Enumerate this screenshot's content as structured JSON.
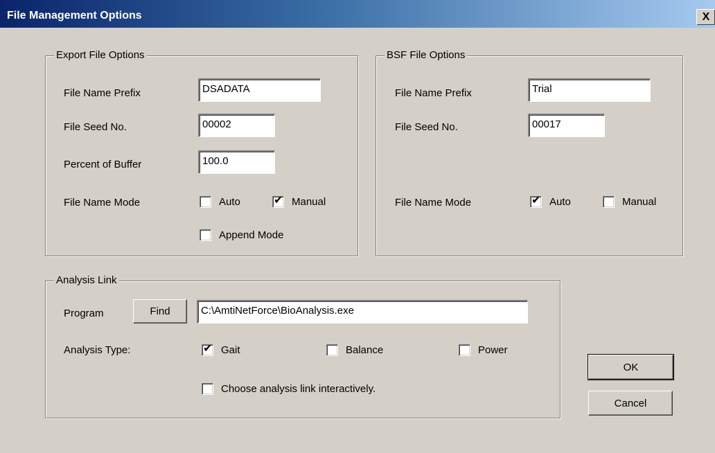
{
  "window": {
    "title": "File Management Options",
    "close_label": "X"
  },
  "export": {
    "title": "Export File Options",
    "prefix_label": "File Name Prefix",
    "prefix_value": "DSADATA",
    "seed_label": "File Seed No.",
    "seed_value": "00002",
    "percent_label": "Percent of Buffer",
    "percent_value": "100.0",
    "mode_label": "File Name Mode",
    "auto_label": "Auto",
    "auto_checked": false,
    "manual_label": "Manual",
    "manual_checked": true,
    "append_label": "Append Mode",
    "append_checked": false
  },
  "bsf": {
    "title": "BSF File Options",
    "prefix_label": "File Name Prefix",
    "prefix_value": "Trial",
    "seed_label": "File Seed No.",
    "seed_value": "00017",
    "mode_label": "File Name Mode",
    "auto_label": "Auto",
    "auto_checked": true,
    "manual_label": "Manual",
    "manual_checked": false
  },
  "analysis": {
    "title": "Analysis Link",
    "program_label": "Program",
    "find_label": "Find",
    "program_value": "C:\\AmtiNetForce\\BioAnalysis.exe",
    "type_label": "Analysis Type:",
    "gait_label": "Gait",
    "gait_checked": true,
    "balance_label": "Balance",
    "balance_checked": false,
    "power_label": "Power",
    "power_checked": false,
    "interactive_label": "Choose analysis link interactively.",
    "interactive_checked": false
  },
  "buttons": {
    "ok": "OK",
    "cancel": "Cancel"
  },
  "check_glyph": "✔"
}
